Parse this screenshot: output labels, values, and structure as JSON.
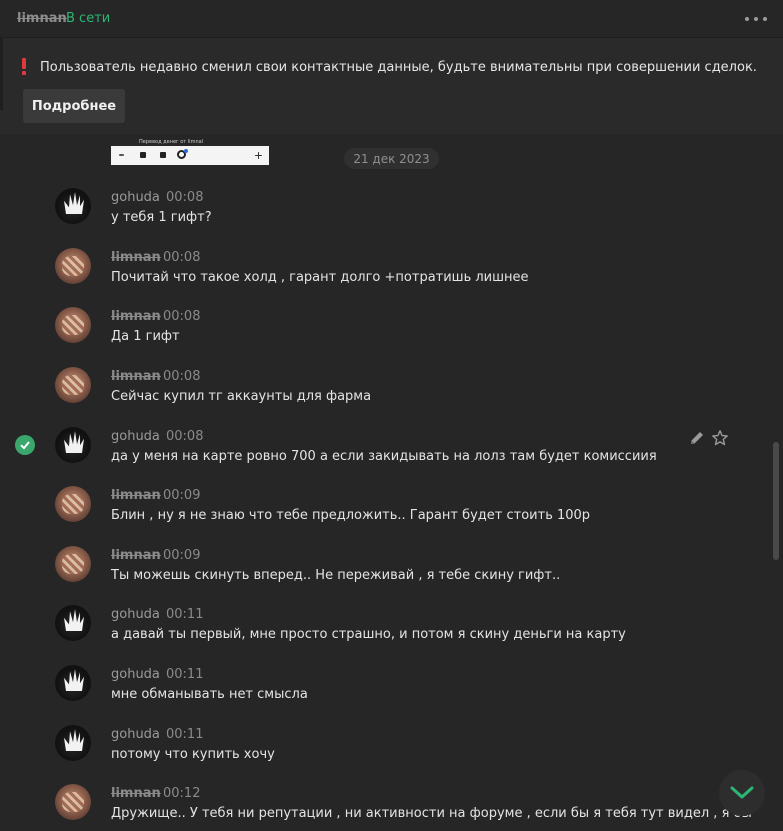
{
  "header": {
    "username": "limnan",
    "status": "В сети",
    "menu_icon": "more-horizontal-icon"
  },
  "notice": {
    "icon": "exclamation-icon",
    "text": "Пользователь недавно сменил свои контактные данные, будьте внимательны при совершении сделок.",
    "button": "Подробнее"
  },
  "pinned": {
    "caption": "Перевод денег от limnal"
  },
  "date_separator": "21 дек 2023",
  "messages": [
    {
      "author": "gohuda",
      "time": "00:08",
      "text": "у тебя 1 гифт?"
    },
    {
      "author": "limnan",
      "time": "00:08",
      "text": "Почитай что такое холд , гарант долго +потратишь лишнее"
    },
    {
      "author": "limnan",
      "time": "00:08",
      "text": "Да 1 гифт"
    },
    {
      "author": "limnan",
      "time": "00:08",
      "text": "Сейчас купил тг аккаунты для фарма"
    },
    {
      "author": "gohuda",
      "time": "00:08",
      "text": "да у меня на карте ровно 700 а если закидывать на лолз там будет комиссиия"
    },
    {
      "author": "limnan",
      "time": "00:09",
      "text": "Блин , ну я не знаю что тебе предложить.. Гарант будет стоить 100р"
    },
    {
      "author": "limnan",
      "time": "00:09",
      "text": "Ты можешь скинуть вперед.. Не переживай , я тебе скину гифт.."
    },
    {
      "author": "gohuda",
      "time": "00:11",
      "text": "а давай ты первый, мне просто страшно, и потом я скину деньги на карту"
    },
    {
      "author": "gohuda",
      "time": "00:11",
      "text": "мне обманывать нет смысла"
    },
    {
      "author": "gohuda",
      "time": "00:11",
      "text": "потому что купить хочу"
    },
    {
      "author": "limnan",
      "time": "00:12",
      "text": "Дружище.. У тебя ни репутации , ни активности на форуме , если бы я тебя тут видел , я бы"
    }
  ],
  "icons": {
    "read_check": "check-circle-icon",
    "edit": "pencil-icon",
    "star": "star-icon",
    "scroll_down": "chevron-down-icon"
  },
  "colors": {
    "online": "#2bb673",
    "warning": "#e0383b",
    "check": "#3aa76d",
    "scroll_arrow": "#2bb673"
  }
}
